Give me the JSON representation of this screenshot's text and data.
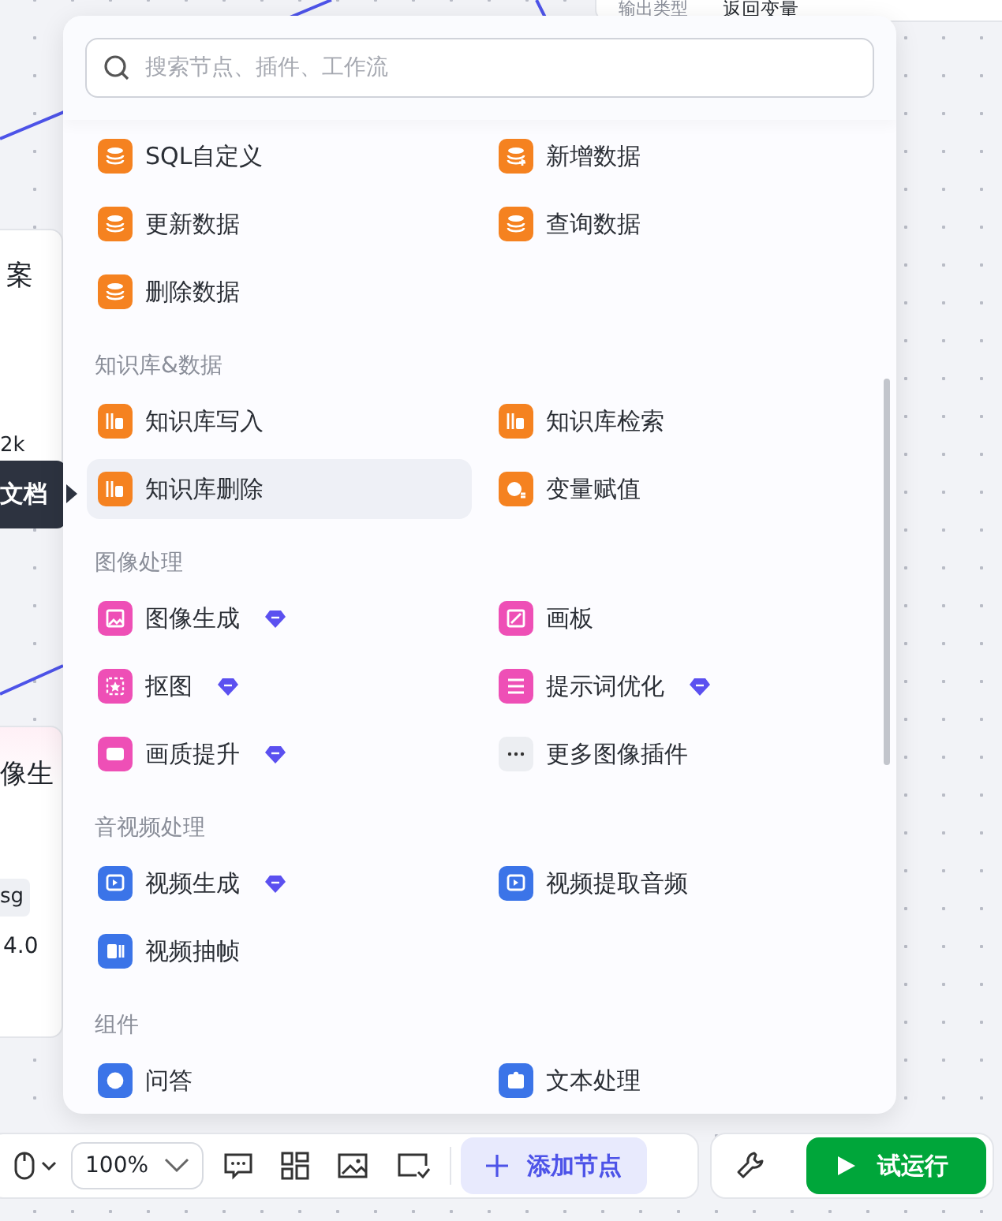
{
  "canvas": {
    "output_card": {
      "label": "输出类型",
      "value": "返回变量"
    },
    "text_node": {
      "title": "案",
      "meta": "2k"
    },
    "tooltip": "文档",
    "image_node": {
      "title": "像生",
      "tag": "sg",
      "version": "4.0"
    }
  },
  "node_panel": {
    "search": {
      "placeholder": "搜索节点、插件、工作流"
    },
    "sections": [
      {
        "items": [
          {
            "label": "SQL自定义",
            "kind": "db",
            "color": "#f58220",
            "premium": false,
            "selected": false
          },
          {
            "label": "新增数据",
            "kind": "db-add",
            "color": "#f58220",
            "premium": false,
            "selected": false
          },
          {
            "label": "更新数据",
            "kind": "db-update",
            "color": "#f58220",
            "premium": false,
            "selected": false
          },
          {
            "label": "查询数据",
            "kind": "db-search",
            "color": "#f58220",
            "premium": false,
            "selected": false
          },
          {
            "label": "删除数据",
            "kind": "db-delete",
            "color": "#f58220",
            "premium": false,
            "selected": false
          }
        ]
      },
      {
        "heading": "知识库&数据",
        "items": [
          {
            "label": "知识库写入",
            "kind": "kb-write",
            "color": "#f58220",
            "premium": false,
            "selected": false
          },
          {
            "label": "知识库检索",
            "kind": "kb",
            "color": "#f58220",
            "premium": false,
            "selected": false
          },
          {
            "label": "知识库删除",
            "kind": "kb",
            "color": "#f58220",
            "premium": false,
            "selected": true
          },
          {
            "label": "变量赋值",
            "kind": "variable",
            "color": "#f58220",
            "premium": false,
            "selected": false
          }
        ]
      },
      {
        "heading": "图像处理",
        "items": [
          {
            "label": "图像生成",
            "kind": "image",
            "color": "#ee4fb6",
            "premium": true,
            "selected": false
          },
          {
            "label": "画板",
            "kind": "board",
            "color": "#ee4fb6",
            "premium": false,
            "selected": false
          },
          {
            "label": "抠图",
            "kind": "cutout",
            "color": "#ee4fb6",
            "premium": true,
            "selected": false
          },
          {
            "label": "提示词优化",
            "kind": "prompt",
            "color": "#ee4fb6",
            "premium": true,
            "selected": false
          },
          {
            "label": "画质提升",
            "kind": "hd",
            "color": "#ee4fb6",
            "premium": true,
            "selected": false
          },
          {
            "label": "更多图像插件",
            "kind": "more",
            "color": "#eceef2",
            "premium": false,
            "selected": false
          }
        ]
      },
      {
        "heading": "音视频处理",
        "items": [
          {
            "label": "视频生成",
            "kind": "video",
            "color": "#3b74e8",
            "premium": true,
            "selected": false
          },
          {
            "label": "视频提取音频",
            "kind": "video",
            "color": "#3b74e8",
            "premium": false,
            "selected": false
          },
          {
            "label": "视频抽帧",
            "kind": "frames",
            "color": "#3b74e8",
            "premium": false,
            "selected": false
          }
        ]
      },
      {
        "heading": "组件",
        "items": [
          {
            "label": "问答",
            "kind": "qa",
            "color": "#3b74e8",
            "premium": false,
            "selected": false
          },
          {
            "label": "文本处理",
            "kind": "text",
            "color": "#3b74e8",
            "premium": false,
            "selected": false
          }
        ]
      }
    ]
  },
  "toolbar": {
    "zoom": "100%",
    "add_button": "添加节点",
    "run_button": "试运行"
  }
}
